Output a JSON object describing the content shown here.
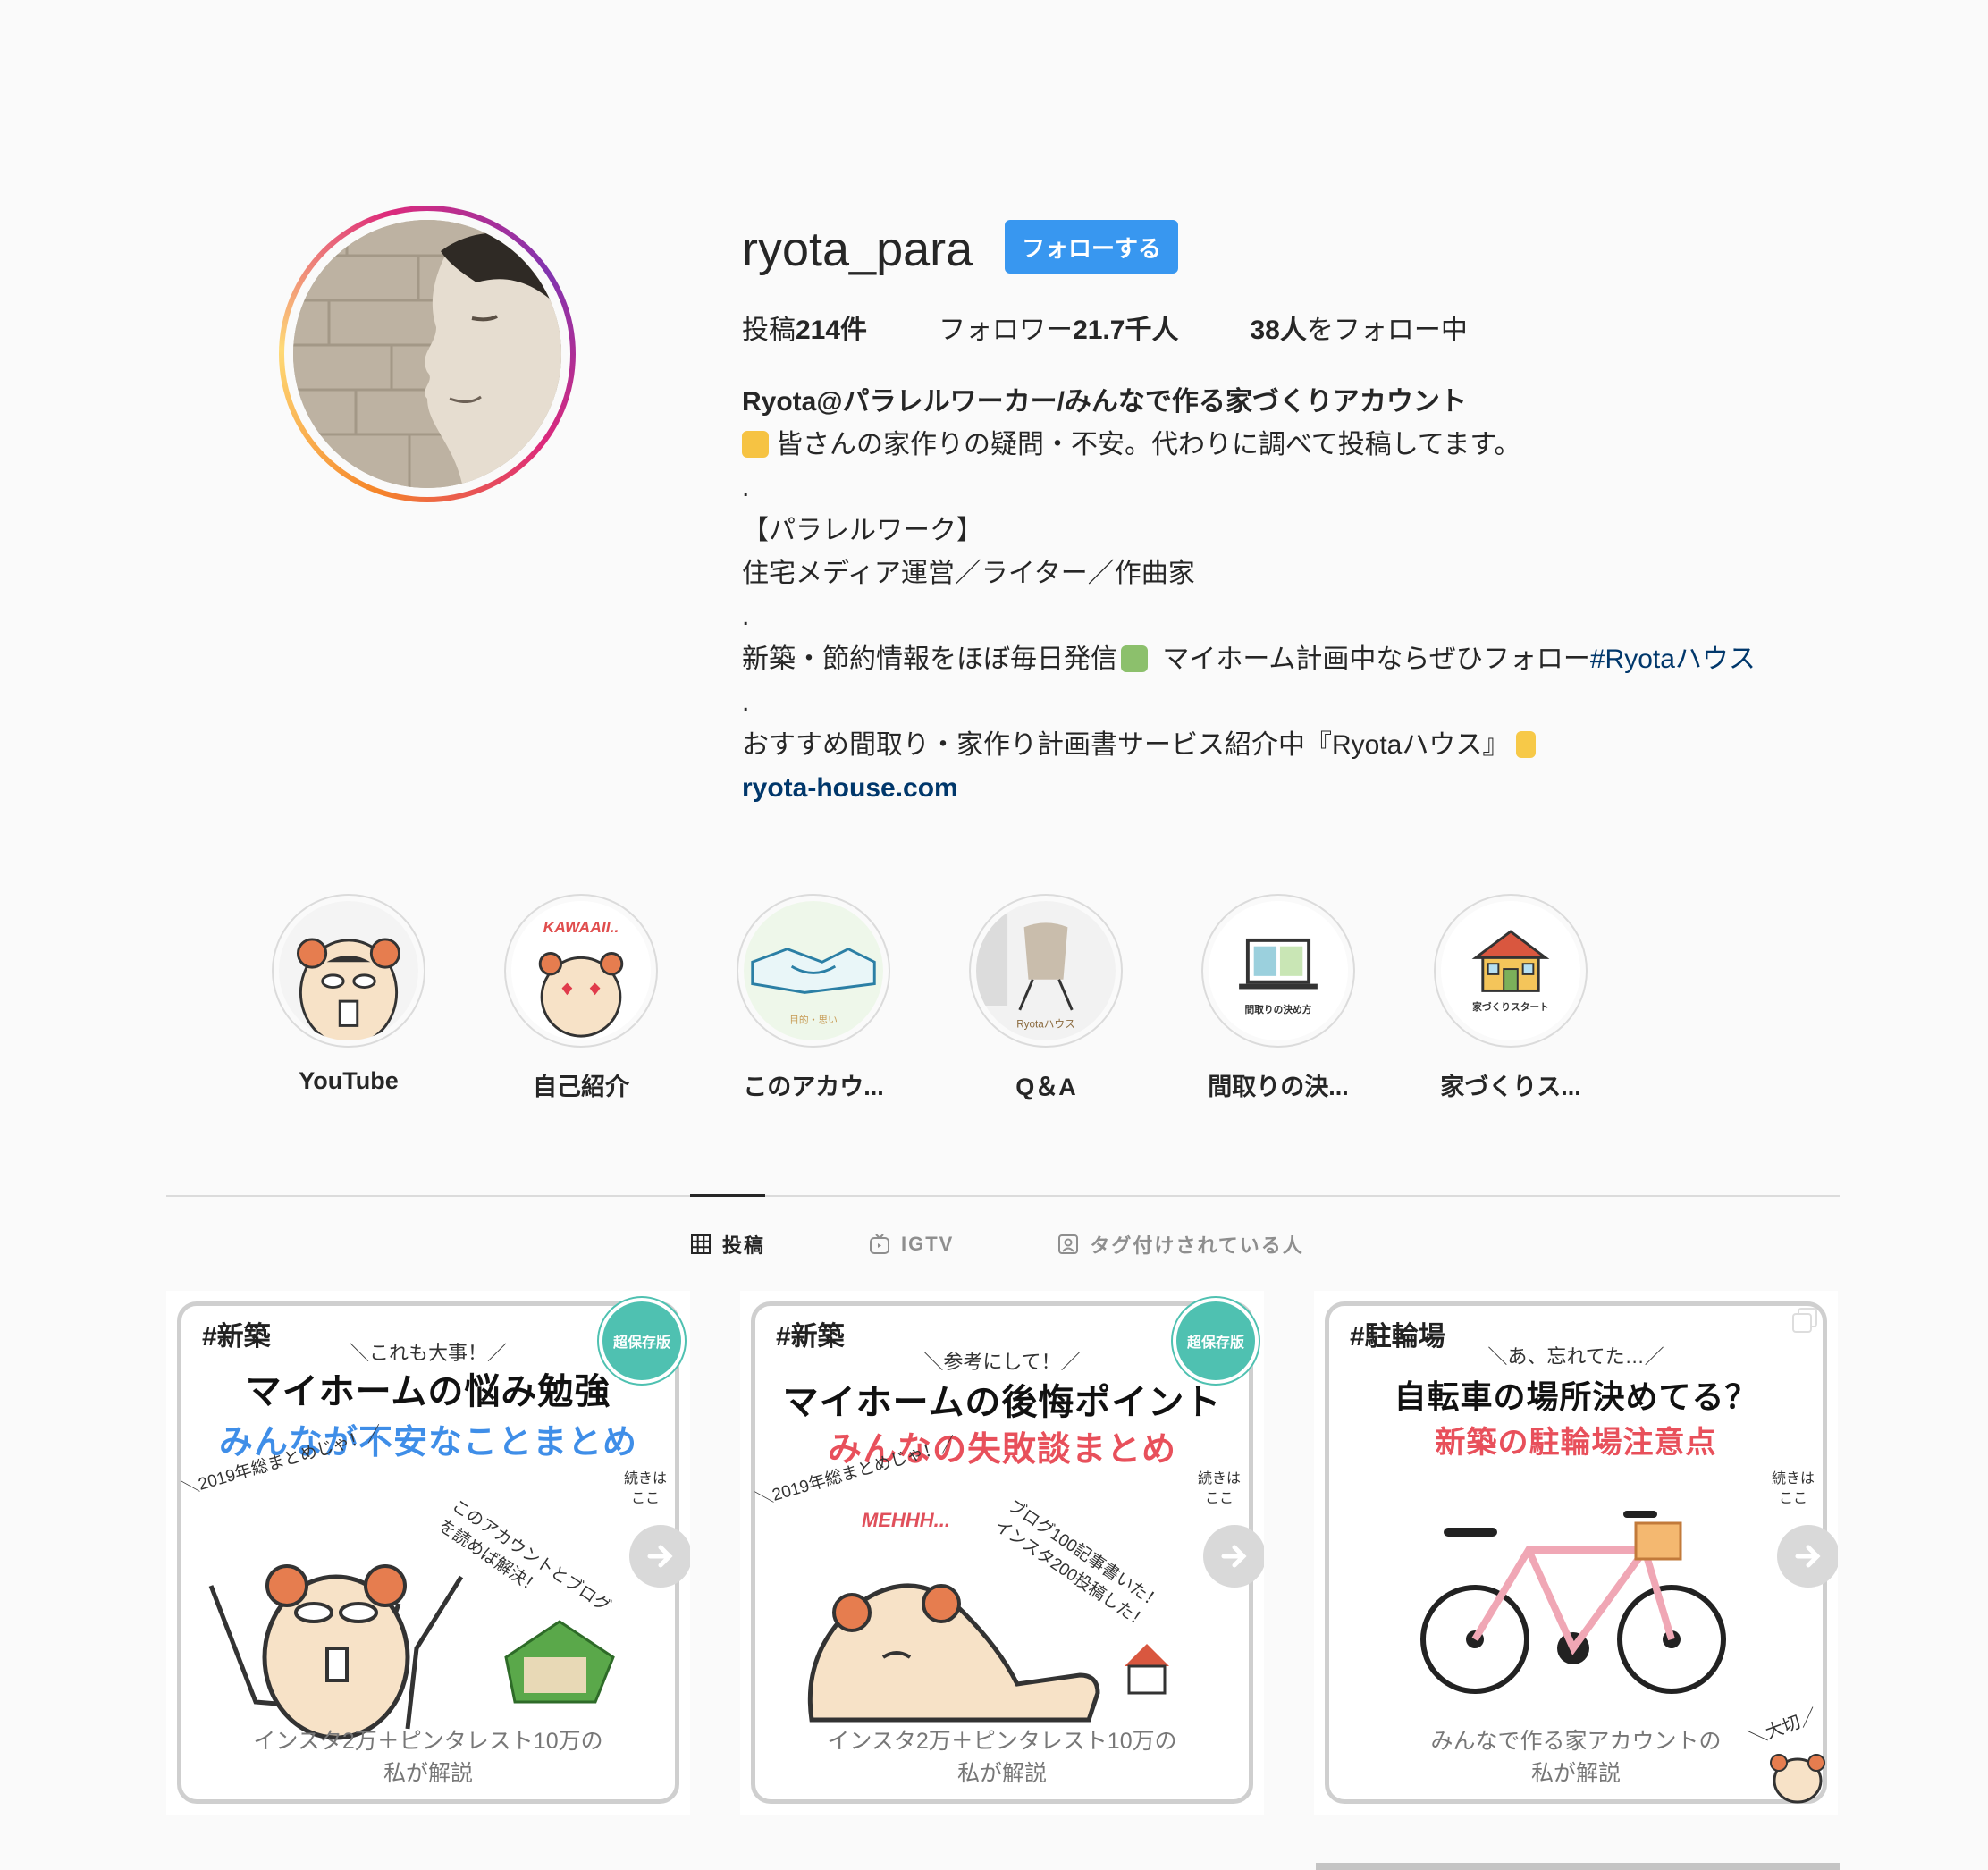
{
  "profile": {
    "username": "ryota_para",
    "follow_label": "フォローする",
    "stats": {
      "posts_label": "投稿",
      "posts_value": "214件",
      "followers_label": "フォロワー",
      "followers_value": "21.7千人",
      "following_value": "38人",
      "following_label": "をフォロー中"
    },
    "bio": {
      "name": "Ryota@パラレルワーカー/みんなで作る家づくりアカウント",
      "line1": "皆さんの家作りの疑問・不安。代わりに調べて投稿してます。",
      "dot": ".",
      "line2": "【パラレルワーク】",
      "line3": "住宅メディア運営／ライター／作曲家",
      "line4_text": "新築・節約情報をほぼ毎日発信",
      "line4_text2": " マイホーム計画中ならぜひフォロー",
      "line4_tag": "#Ryotaハウス",
      "line5": "おすすめ間取り・家作り計画書サービス紹介中『Ryotaハウス』",
      "link": "ryota-house.com"
    }
  },
  "highlights": [
    {
      "label": "YouTube"
    },
    {
      "label": "自己紹介",
      "img_text": "KAWAAII.."
    },
    {
      "label": "このアカウ...",
      "img_text": "目的・思い"
    },
    {
      "label": "Q＆A",
      "img_text": "Ryotaハウス"
    },
    {
      "label": "間取りの決...",
      "img_text": "間取りの決め方"
    },
    {
      "label": "家づくりス...",
      "img_text": "家づくりスタート"
    }
  ],
  "tabs": [
    {
      "label": "投稿",
      "icon": "grid-icon",
      "active": true
    },
    {
      "label": "IGTV",
      "icon": "igtv-icon",
      "active": false
    },
    {
      "label": "タグ付けされている人",
      "icon": "tagged-person-icon",
      "active": false
    }
  ],
  "posts": [
    {
      "hashtag": "#新築",
      "sub": "＼これも大事！／",
      "title": "マイホームの悩み勉強",
      "title2": "みんなが不安なことまとめ",
      "title2_color": "#3f8ee8",
      "badge": "超保存版",
      "note1": "＼2019年総まとめじゃ！／",
      "note2": "このアカウントとブログを読めば解決！",
      "continue": "続きは ここ",
      "foot1": "インスタ2万＋ピンタレスト10万の",
      "foot2": "私が解説"
    },
    {
      "hashtag": "#新築",
      "sub": "＼参考にして！／",
      "title": "マイホームの後悔ポイント",
      "title2": "みんなの失敗談まとめ",
      "title2_color": "#e8505b",
      "badge": "超保存版",
      "note1": "＼2019年総まとめじゃ！／",
      "note2": "ブログ100記事書いた！インスタ200投稿した！",
      "exclaim": "MEHHH...",
      "continue": "続きは ここ",
      "foot1": "インスタ2万＋ピンタレスト10万の",
      "foot2": "私が解説"
    },
    {
      "hashtag": "#駐輪場",
      "sub": "＼あ、忘れてた…／",
      "title": "自転車の場所決めてる？",
      "title2": "新築の駐輪場注意点",
      "title2_color": "#e8505b",
      "continue": "続きは ここ",
      "note_right": "＼大切／",
      "foot1": "みんなで作る家アカウントの",
      "foot2": "私が解説"
    }
  ]
}
